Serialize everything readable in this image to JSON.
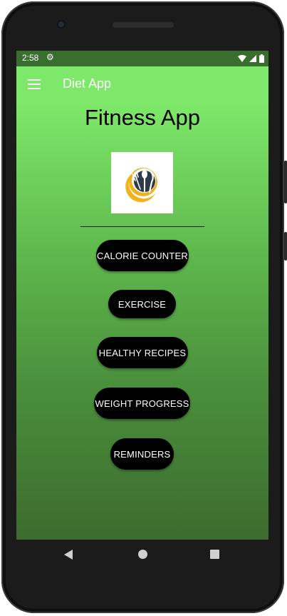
{
  "status_bar": {
    "time": "2:58",
    "icons": [
      "gear-icon",
      "wifi-icon",
      "signal-icon",
      "battery-icon"
    ]
  },
  "app_bar": {
    "menu_icon": "hamburger-menu-icon",
    "title": "Diet App"
  },
  "main": {
    "title": "Fitness App",
    "logo_icon": "fork-spoon-knife-logo-icon",
    "buttons": [
      {
        "label": "CALORIE COUNTER"
      },
      {
        "label": "EXERCISE"
      },
      {
        "label": "HEALTHY RECIPES"
      },
      {
        "label": "WEIGHT PROGRESS"
      },
      {
        "label": "REMINDERS"
      }
    ]
  },
  "system_nav": {
    "icons": [
      "back-icon",
      "home-icon",
      "recents-icon"
    ]
  },
  "colors": {
    "app_bar": "#7ee86a",
    "status_bar": "#3a6e2e",
    "gradient_top": "#7ee86a",
    "gradient_bottom": "#3d6b2f",
    "button": "#000000",
    "logo_accent": "#f2b21d"
  }
}
